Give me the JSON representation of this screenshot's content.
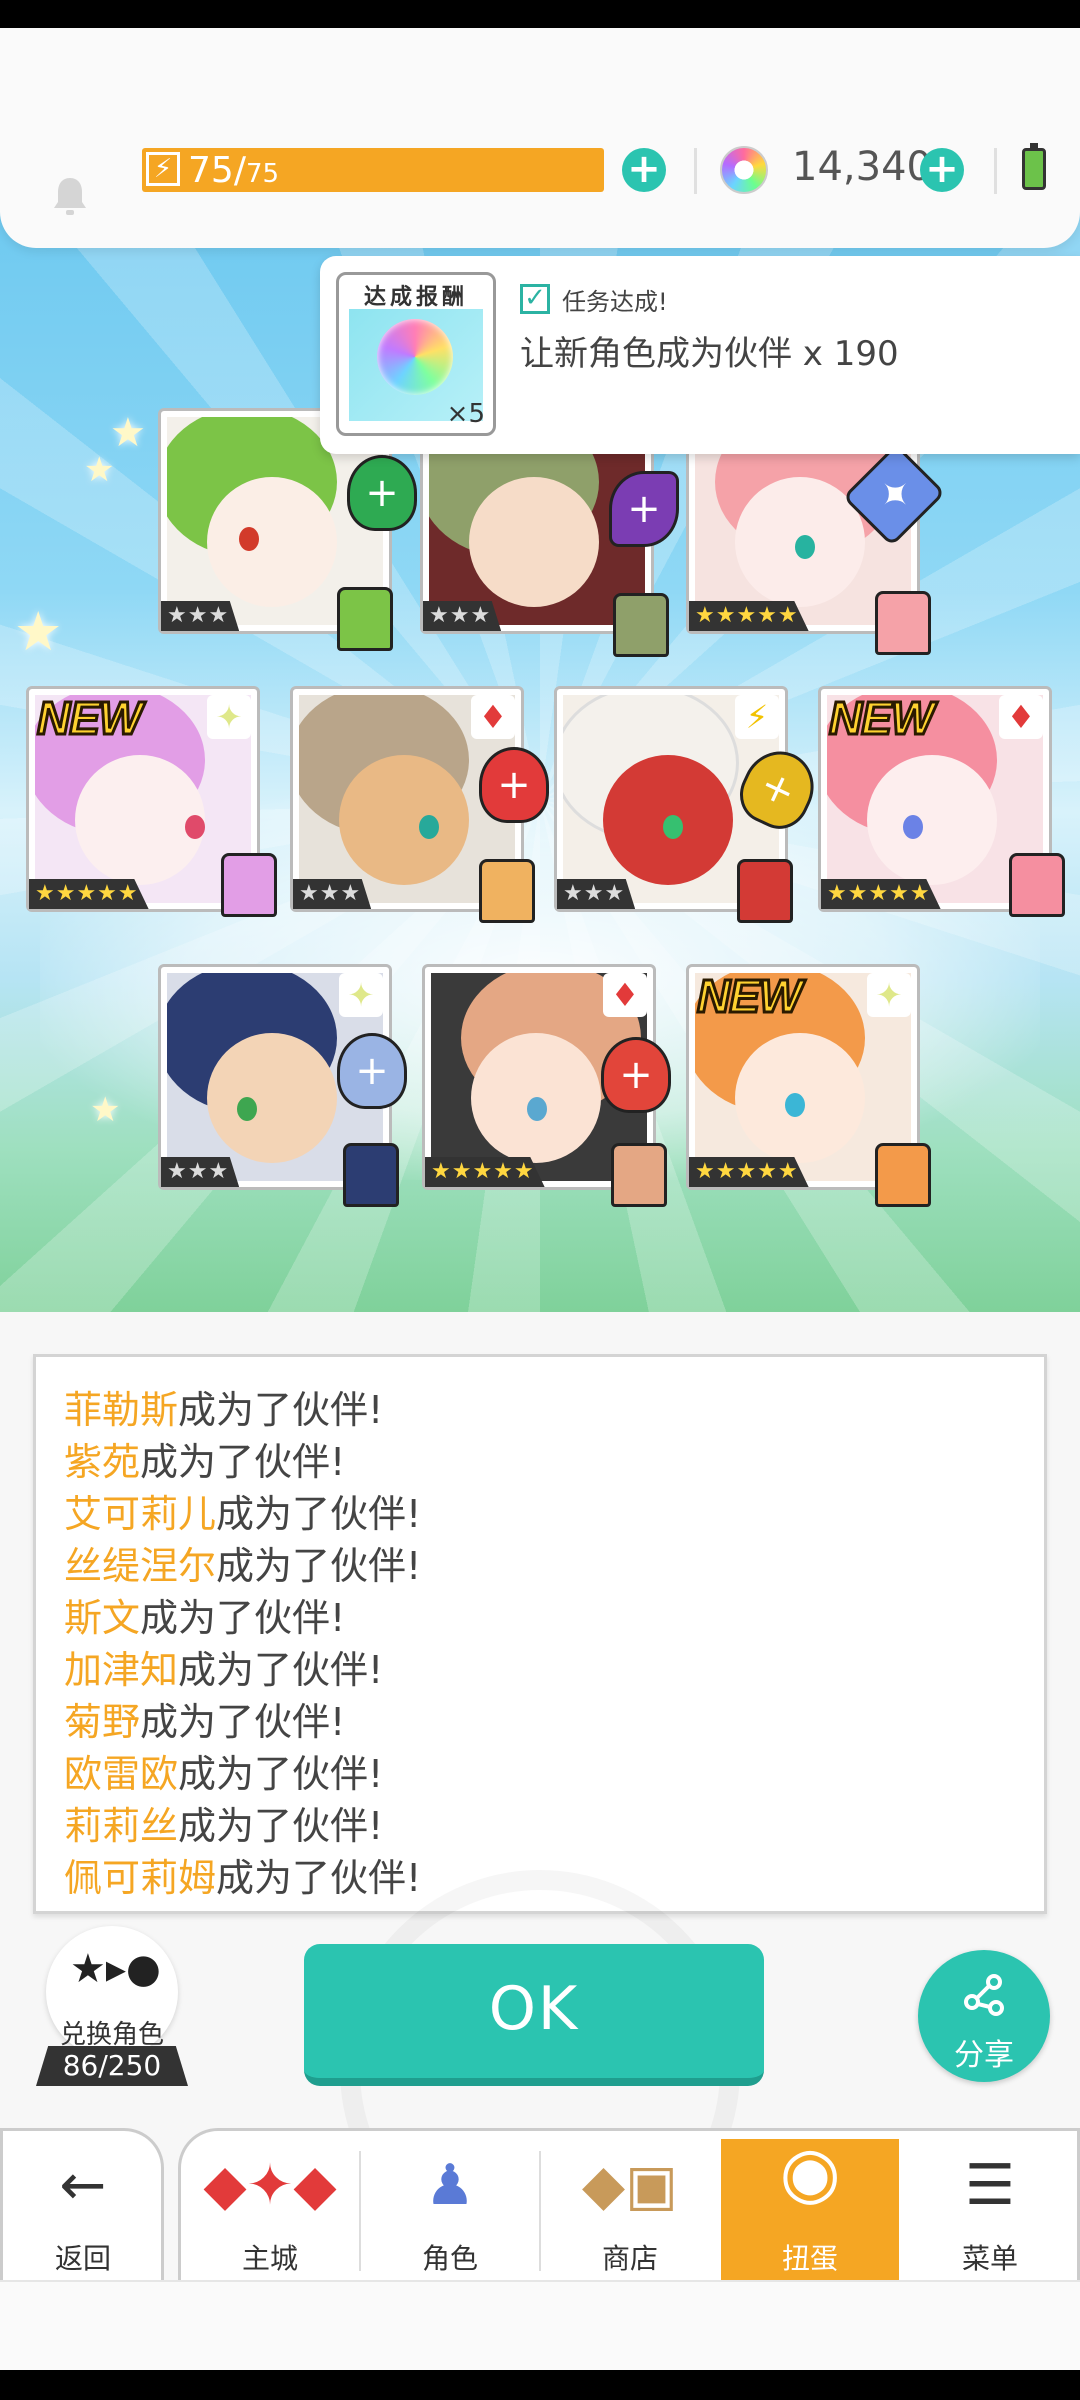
{
  "header": {
    "energy_current": "75",
    "energy_max": "75",
    "gem_count": "14,340"
  },
  "reward": {
    "title": "达成报酬",
    "quantity": "×5",
    "status": "任务达成!",
    "description": "让新角色成为伙伴  x 190"
  },
  "cards": [
    {
      "rarity": "★★★",
      "new": "",
      "element": "leaf"
    },
    {
      "rarity": "★★★",
      "new": "",
      "element": "dark"
    },
    {
      "rarity": "★★★★★",
      "new": "",
      "element": "star"
    },
    {
      "rarity": "★★★★★",
      "new": "NEW",
      "element": "light"
    },
    {
      "rarity": "★★★",
      "new": "",
      "element": "fire"
    },
    {
      "rarity": "★★★",
      "new": "",
      "element": "thunder"
    },
    {
      "rarity": "★★★★★",
      "new": "NEW",
      "element": "fire"
    },
    {
      "rarity": "★★★",
      "new": "",
      "element": "light"
    },
    {
      "rarity": "★★★★★",
      "new": "",
      "element": "fire"
    },
    {
      "rarity": "★★★★★",
      "new": "NEW",
      "element": "light"
    }
  ],
  "log": {
    "suffix": "成为了伙伴!",
    "names": [
      "菲勒斯",
      "紫苑",
      "艾可莉儿",
      "丝缇涅尔",
      "斯文",
      "加津知",
      "菊野",
      "欧雷欧",
      "莉莉丝",
      "佩可莉姆"
    ]
  },
  "controls": {
    "exchange_label": "兑换角色",
    "exchange_count": "86/250",
    "ok_label": "OK",
    "share_label": "分享"
  },
  "nav": {
    "back": "返回",
    "items": [
      "主城",
      "角色",
      "商店",
      "扭蛋",
      "菜单"
    ],
    "active_index": 3
  },
  "colors": {
    "accent": "#2bc4b0",
    "energy": "#f5a623",
    "name_highlight": "#f5a623"
  }
}
